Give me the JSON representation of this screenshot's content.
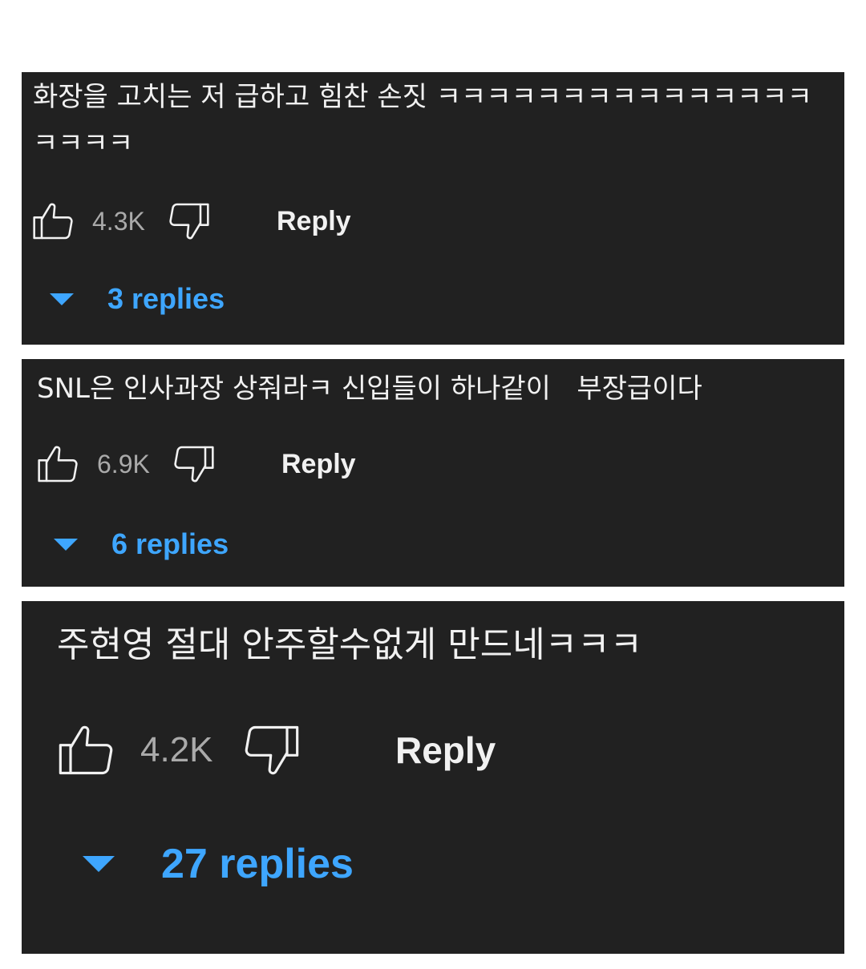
{
  "comments": [
    {
      "text": "화장을 고치는 저 급하고 힘찬 손짓 ㅋㅋㅋㅋㅋㅋㅋㅋㅋㅋㅋㅋㅋㅋㅋㅋㅋㅋㅋ",
      "like_count": "4.3K",
      "reply_label": "Reply",
      "replies_label": "3 replies",
      "icons": {
        "like": "thumbs-up-icon",
        "dislike": "thumbs-down-icon",
        "expand": "caret-down-icon"
      }
    },
    {
      "text": "SNL은 인사과장 상줘라ㅋ 신입들이 하나같이   부장급이다",
      "like_count": "6.9K",
      "reply_label": "Reply",
      "replies_label": "6 replies",
      "icons": {
        "like": "thumbs-up-icon",
        "dislike": "thumbs-down-icon",
        "expand": "caret-down-icon"
      }
    },
    {
      "text": "주현영 절대 안주할수없게 만드네ㅋㅋㅋ",
      "like_count": "4.2K",
      "reply_label": "Reply",
      "replies_label": "27 replies",
      "icons": {
        "like": "thumbs-up-icon",
        "dislike": "thumbs-down-icon",
        "expand": "caret-down-icon"
      }
    }
  ],
  "colors": {
    "card_background": "#212121",
    "page_background": "#ffffff",
    "text": "#f1f1f1",
    "count": "#aaaaaa",
    "replies_link": "#3ea6ff"
  }
}
